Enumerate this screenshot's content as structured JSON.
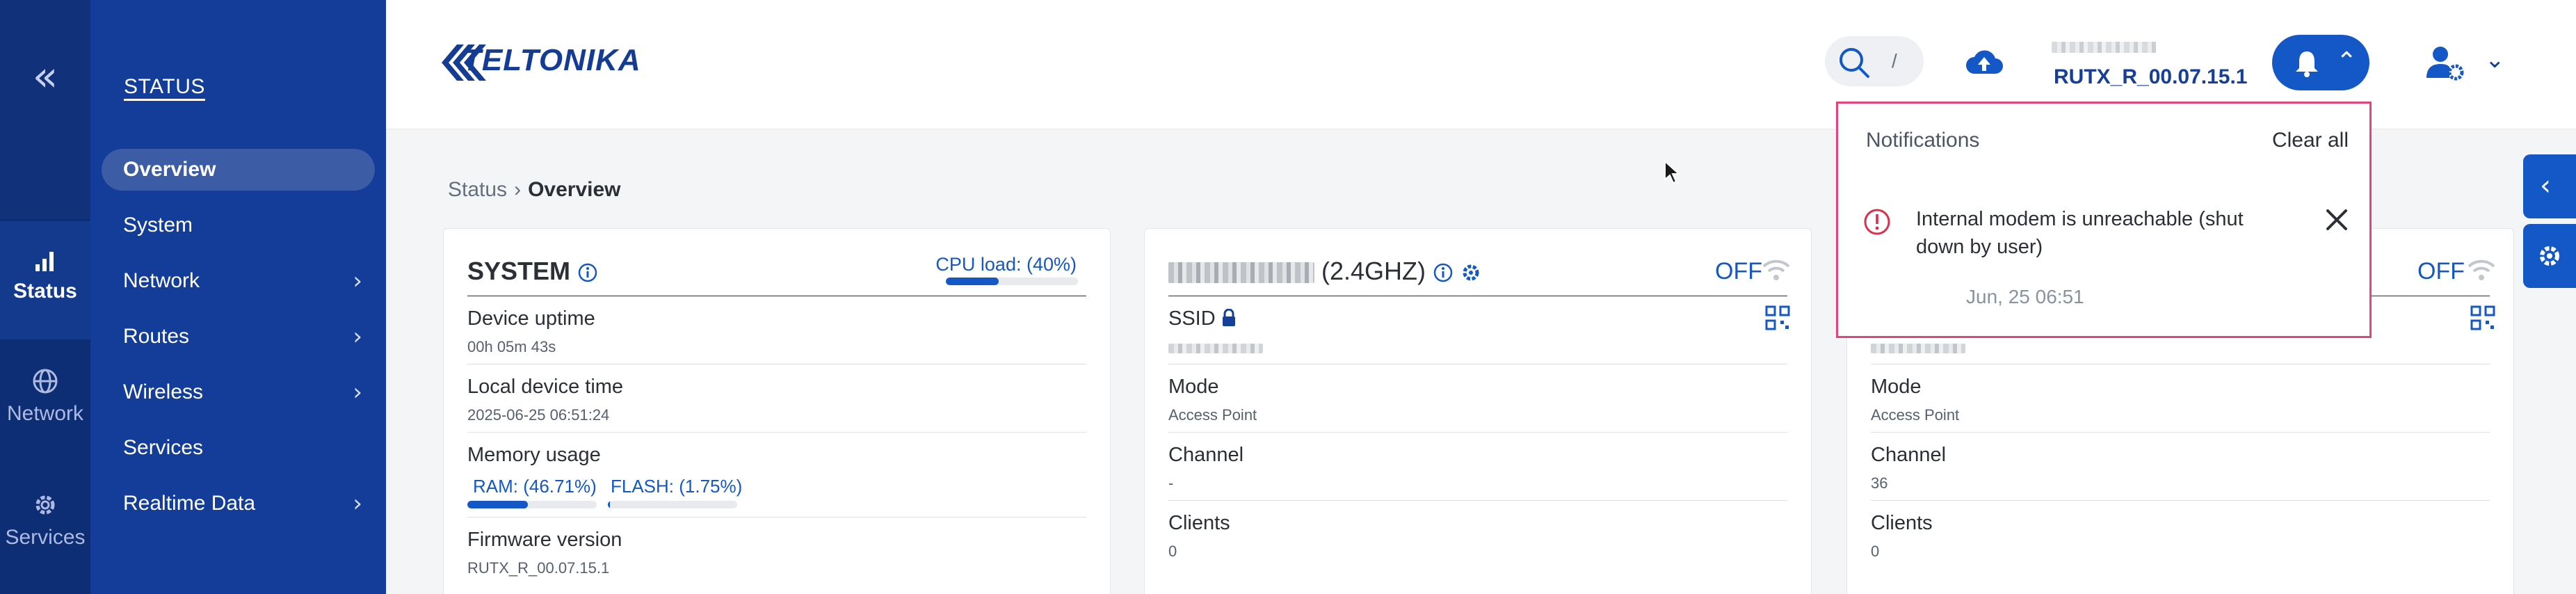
{
  "rail": {
    "items": [
      {
        "label": "Status",
        "icon": "signal-bars-icon"
      },
      {
        "label": "Network",
        "icon": "globe-icon"
      },
      {
        "label": "Services",
        "icon": "gear-icon"
      }
    ]
  },
  "menu": {
    "heading": "STATUS",
    "items": [
      {
        "label": "Overview"
      },
      {
        "label": "System"
      },
      {
        "label": "Network"
      },
      {
        "label": "Routes"
      },
      {
        "label": "Wireless"
      },
      {
        "label": "Services"
      },
      {
        "label": "Realtime Data"
      }
    ]
  },
  "header": {
    "logo_text": "TELTONIKA",
    "search_shortcut": "/",
    "firmware": "RUTX_R_00.07.15.1"
  },
  "breadcrumb": {
    "root": "Status",
    "current": "Overview"
  },
  "system_card": {
    "title": "SYSTEM",
    "cpu_label": "CPU load: (40%)",
    "cpu_load": 0.4,
    "uptime_label": "Device uptime",
    "uptime_value": "00h 05m 43s",
    "time_label": "Local device time",
    "time_value": "2025-06-25 06:51:24",
    "memory_label": "Memory usage",
    "ram_label": "RAM: (46.71%)",
    "ram_usage": 0.4671,
    "flash_label": "FLASH: (1.75%)",
    "flash_usage": 0.0175,
    "firmware_label": "Firmware version",
    "firmware_value": "RUTX_R_00.07.15.1"
  },
  "wifi24_card": {
    "title_suffix": "(2.4GHZ)",
    "state": "OFF",
    "ssid_label": "SSID",
    "mode_label": "Mode",
    "mode_value": "Access Point",
    "channel_label": "Channel",
    "channel_value": "-",
    "clients_label": "Clients",
    "clients_value": "0"
  },
  "wifi5_card": {
    "state": "OFF",
    "mode_label": "Mode",
    "mode_value": "Access Point",
    "channel_label": "Channel",
    "channel_value": "36",
    "clients_label": "Clients",
    "clients_value": "0"
  },
  "notifications": {
    "title": "Notifications",
    "clear_all": "Clear all",
    "items": [
      {
        "message": "Internal modem is unreachable (shut down by user)",
        "time": "Jun, 25 06:51"
      }
    ]
  },
  "colors": {
    "rail": "#0d2d74",
    "menu": "#133d98",
    "accent": "#1358c6",
    "popup_border": "#e0457b"
  }
}
